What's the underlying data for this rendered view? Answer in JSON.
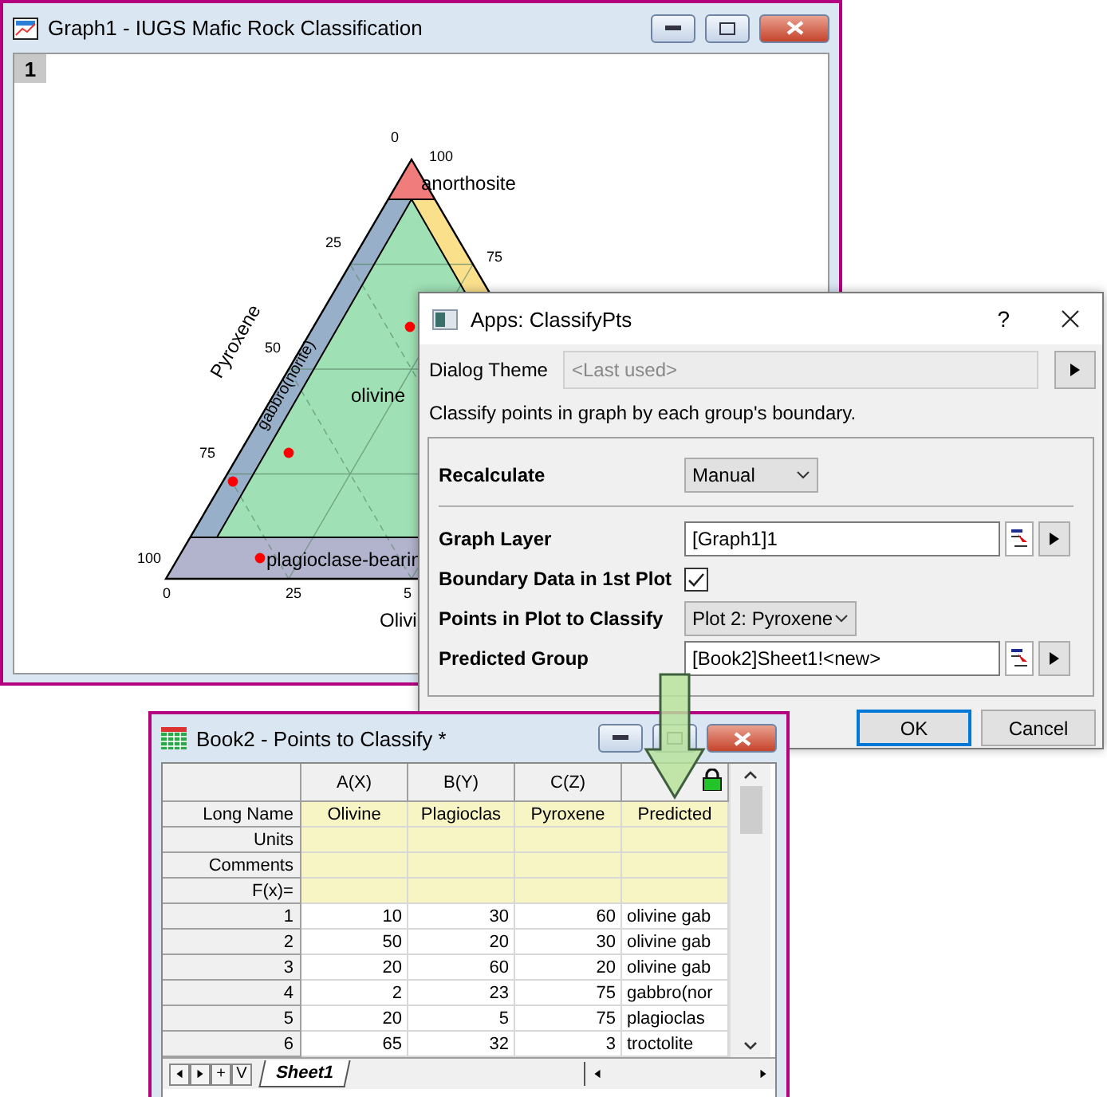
{
  "graph_window": {
    "title": "Graph1 - IUGS Mafic Rock Classification",
    "layer": "1",
    "tick_labels": [
      "0",
      "100",
      "25",
      "50",
      "75",
      "100",
      "0",
      "25",
      "5",
      "75"
    ],
    "axis_titles": [
      "Pyroxene",
      "Olivi"
    ],
    "region_labels": [
      "anorthosite",
      "gabbro(norite)",
      "olivine",
      "plagioclase-bearin"
    ]
  },
  "dialog": {
    "title": "Apps: ClassifyPts",
    "help": "?",
    "theme_label": "Dialog Theme",
    "theme_placeholder": "<Last used>",
    "description": "Classify points in graph by each group's boundary.",
    "fields": [
      {
        "kind": "dropdown",
        "label": "Recalculate",
        "value": "Manual"
      },
      {
        "kind": "input",
        "label": "Graph Layer",
        "value": "[Graph1]1"
      },
      {
        "kind": "checkbox",
        "label": "Boundary Data in 1st Plot",
        "checked": true
      },
      {
        "kind": "dropdown",
        "label": "Points in Plot to Classify",
        "value": "Plot 2: Pyroxene"
      },
      {
        "kind": "input",
        "label": "Predicted Group",
        "value": "[Book2]Sheet1!<new>"
      }
    ],
    "buttons": [
      {
        "label": "OK",
        "default": true
      },
      {
        "label": "Cancel",
        "default": false
      }
    ]
  },
  "book": {
    "title": "Book2 - Points to Classify *",
    "headers": [
      "A(X)",
      "B(Y)",
      "C(Z)"
    ],
    "label_rows": [
      {
        "label": "Long Name",
        "cells": [
          "Olivine",
          "Plagioclas",
          "Pyroxene",
          "Predicted"
        ]
      },
      {
        "label": "Units"
      },
      {
        "label": "Comments"
      },
      {
        "label": "F(x)="
      }
    ],
    "rows": [
      {
        "index": "1",
        "cells": [
          "10",
          "30",
          "60",
          "olivine gab"
        ]
      },
      {
        "index": "2",
        "cells": [
          "50",
          "20",
          "30",
          "olivine gab"
        ]
      },
      {
        "index": "3",
        "cells": [
          "20",
          "60",
          "20",
          "olivine gab"
        ]
      },
      {
        "index": "4",
        "cells": [
          "2",
          "23",
          "75",
          "gabbro(nor"
        ]
      },
      {
        "index": "5",
        "cells": [
          "20",
          "5",
          "75",
          "plagioclas"
        ]
      },
      {
        "index": "6",
        "cells": [
          "65",
          "32",
          "3",
          "troctolite"
        ]
      }
    ],
    "nav": [
      "+",
      "V"
    ],
    "sheet_tabs": [
      {
        "label": "Sheet1",
        "selected": true
      }
    ]
  }
}
